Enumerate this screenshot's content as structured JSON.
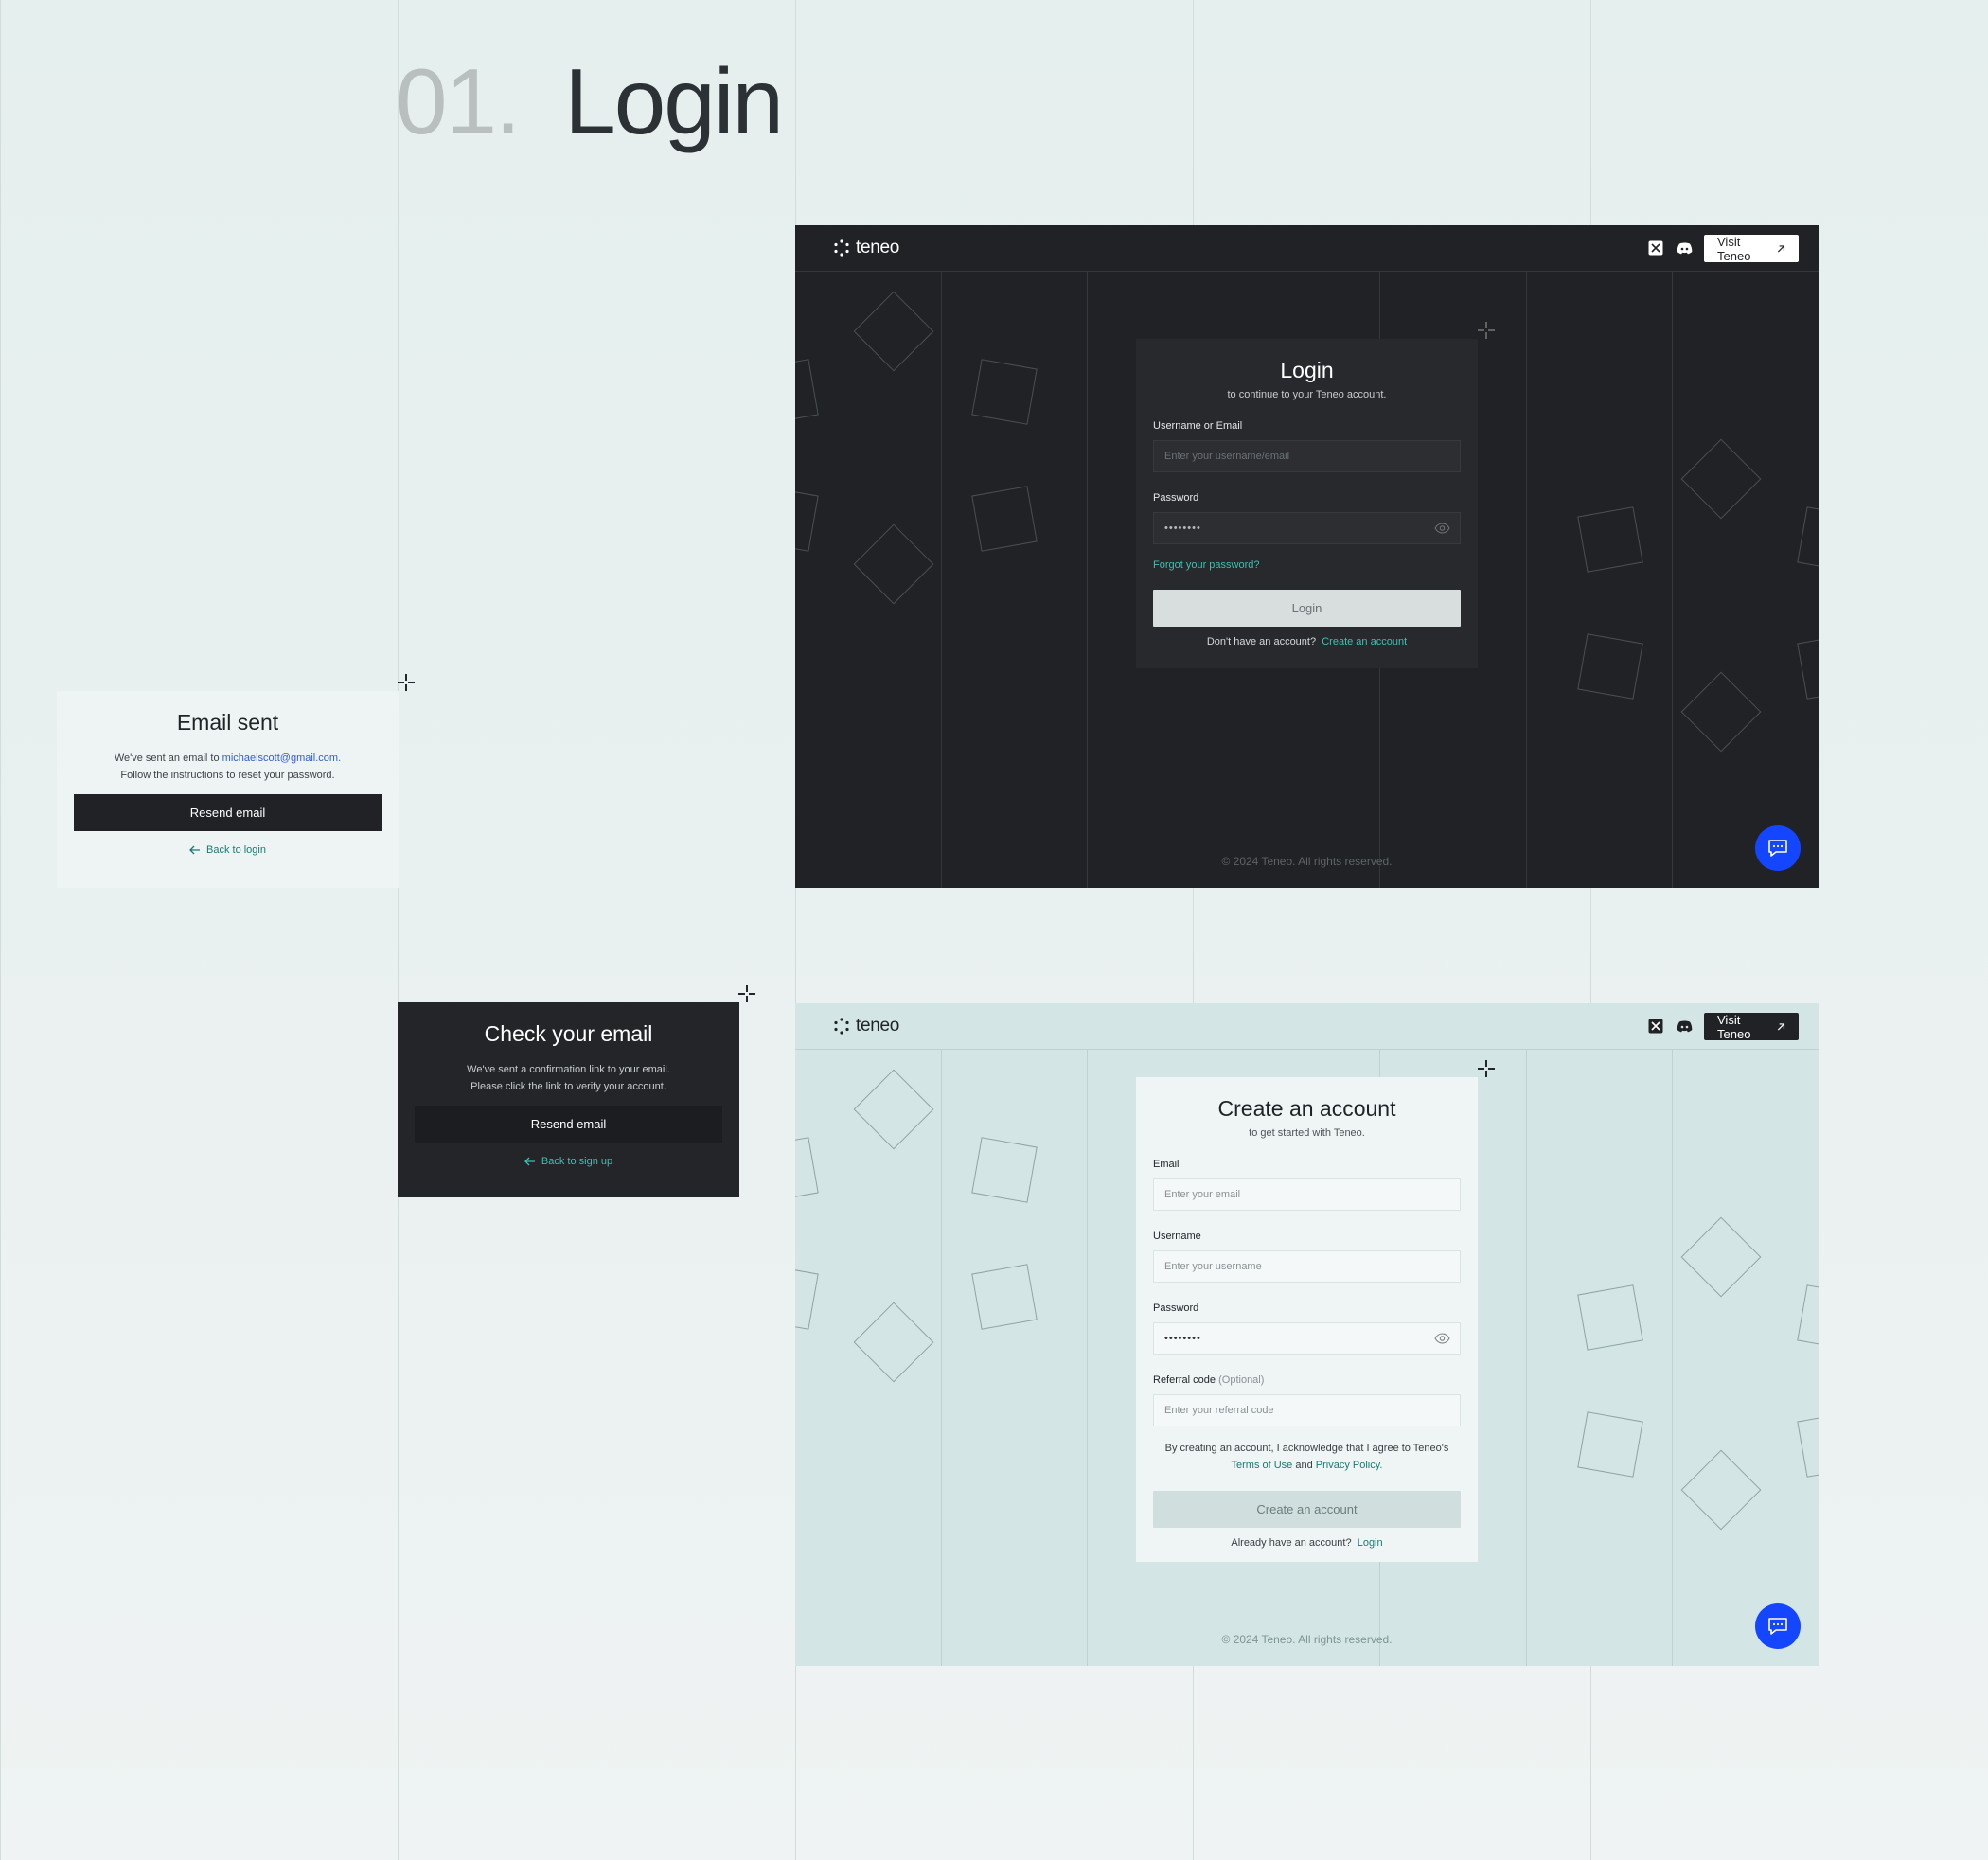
{
  "page": {
    "number": "01.",
    "title": "Login"
  },
  "brand": {
    "name": "teneo",
    "accent": "#3fbfb2",
    "chat_fab": "#1446ff"
  },
  "header": {
    "visit_label": "Visit Teneo"
  },
  "login": {
    "title": "Login",
    "subtitle": "to continue to your Teneo account.",
    "username_label": "Username or Email",
    "username_placeholder": "Enter your username/email",
    "password_label": "Password",
    "password_value": "••••••••",
    "forgot": "Forgot your password?",
    "submit": "Login",
    "no_account": "Don't have an account?",
    "create_link": "Create an account",
    "footer": "© 2024 Teneo. All rights reserved."
  },
  "signup": {
    "title": "Create an account",
    "subtitle": "to get started with Teneo.",
    "email_label": "Email",
    "email_placeholder": "Enter your email",
    "username_label": "Username",
    "username_placeholder": "Enter your username",
    "password_label": "Password",
    "password_value": "••••••••",
    "referral_label": "Referral code",
    "referral_optional": "(Optional)",
    "referral_placeholder": "Enter your referral code",
    "legal_prefix": "By creating an account, I acknowledge that I agree to Teneo's",
    "terms": "Terms of Use",
    "and": "and",
    "privacy": "Privacy Policy.",
    "submit": "Create an account",
    "have_account": "Already have an account?",
    "login_link": "Login",
    "footer": "© 2024 Teneo. All rights reserved."
  },
  "email_sent": {
    "title": "Email sent",
    "text_prefix": "We've sent an email to",
    "email": "michaelscott@gmail.com.",
    "text_line2": "Follow the instructions to reset your password.",
    "resend": "Resend email",
    "back": "Back to login"
  },
  "check_email": {
    "title": "Check your email",
    "line1": "We've sent a confirmation link to your email.",
    "line2": "Please click the link to verify your account.",
    "resend": "Resend email",
    "back": "Back to sign up"
  }
}
